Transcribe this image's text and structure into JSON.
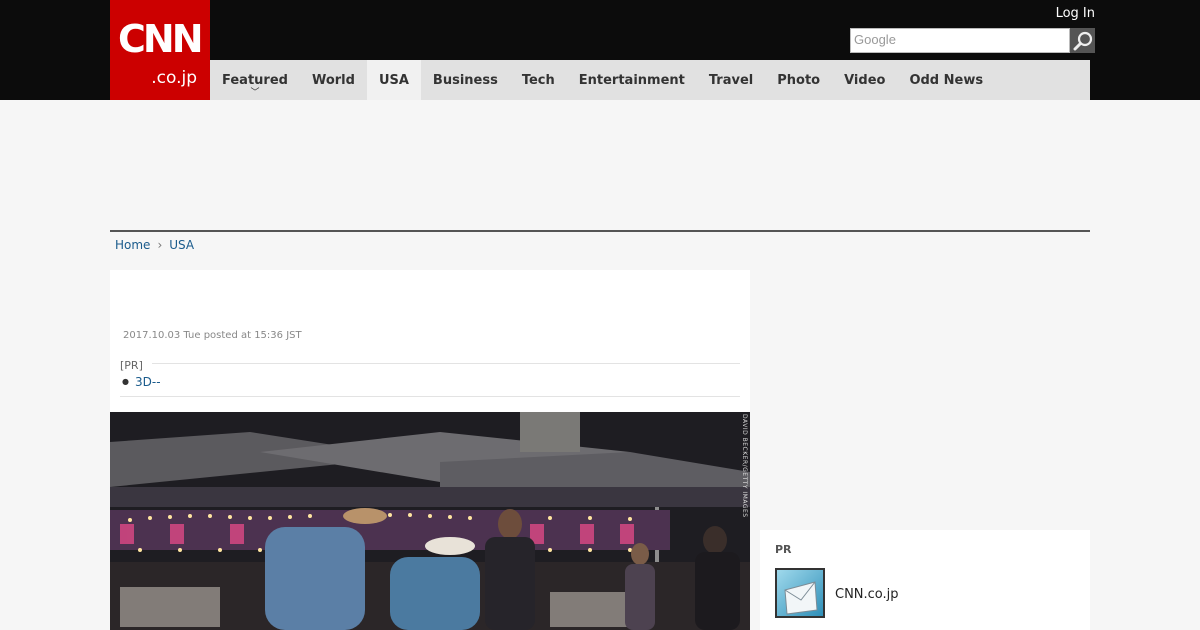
{
  "header": {
    "logo_top": "CNN",
    "logo_bottom": ".co.jp",
    "login_label": "Log In",
    "search_placeholder": "Google",
    "colors": {
      "brand": "#cc0000",
      "topbar": "#0c0c0c",
      "nav_bg": "#e1e1e1"
    }
  },
  "nav": {
    "items": [
      {
        "label": "Featured"
      },
      {
        "label": "World"
      },
      {
        "label": "USA",
        "active": true
      },
      {
        "label": "Business"
      },
      {
        "label": "Tech"
      },
      {
        "label": "Entertainment"
      },
      {
        "label": "Travel"
      },
      {
        "label": "Photo"
      },
      {
        "label": "Video"
      },
      {
        "label": "Odd News"
      }
    ]
  },
  "breadcrumb": {
    "home": "Home",
    "section": "USA"
  },
  "article": {
    "posted": "2017.10.03 Tue posted at 15:36 JST",
    "pr_label": "[PR]",
    "pr_link": "3D--",
    "photo_credit": "DAVID BECKER/GETTY IMAGES"
  },
  "sidebar_pr": {
    "title": "PR",
    "item_label": "CNN.co.jp"
  }
}
